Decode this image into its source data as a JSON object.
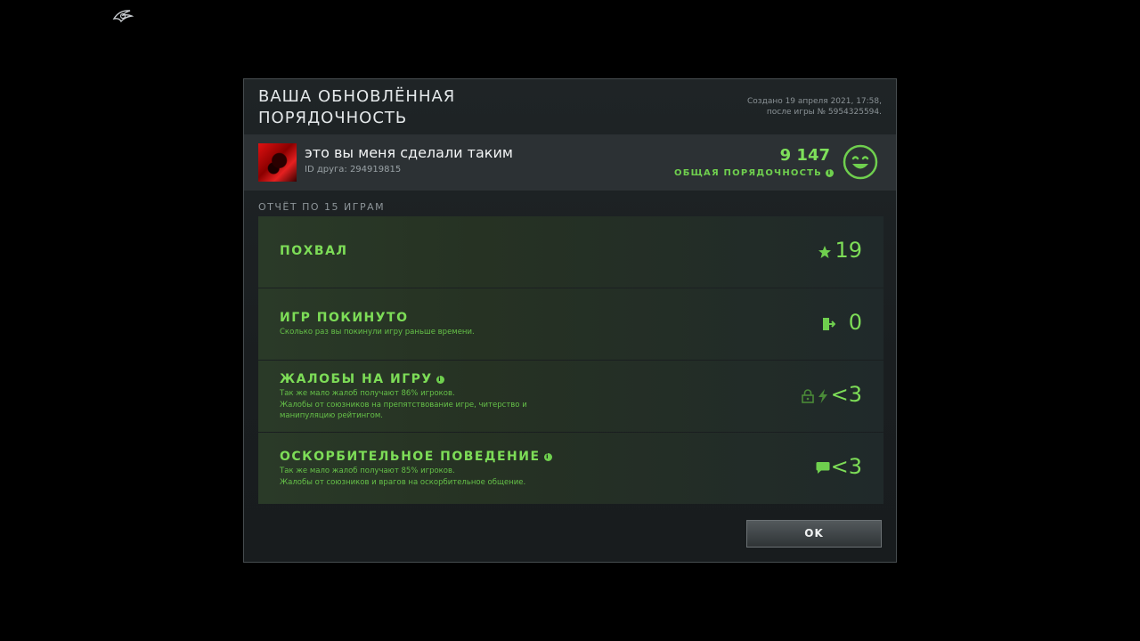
{
  "header": {
    "title": "ВАША ОБНОВЛЁННАЯ\nПОРЯДОЧНОСТЬ",
    "created": "Создано 19 апреля 2021, 17:58,\nпосле игры № 5954325594."
  },
  "profile": {
    "nickname": "это вы меня сделали таким",
    "friend_id": "ID друга: 294919815",
    "behavior_score": "9 147",
    "behavior_label": "ОБЩАЯ ПОРЯДОЧНОСТЬ"
  },
  "report": {
    "title": "ОТЧЁТ ПО 15 ИГРАМ",
    "rows": [
      {
        "label": "ПОХВАЛ",
        "desc": "",
        "value": "19",
        "icons": [
          "commend-star-icon"
        ]
      },
      {
        "label": "ИГР ПОКИНУТО",
        "desc": "Сколько раз вы покинули игру раньше времени.",
        "value": "0",
        "icons": [
          "abandon-door-icon"
        ]
      },
      {
        "label": "ЖАЛОБЫ НА ИГРУ",
        "desc": "Так же мало жалоб получают 86% игроков.\nЖалобы от союзников на препятствование игре, читерство и\nманипуляцию рейтингом.",
        "value": "<3",
        "icons": [
          "lock-icon",
          "lightning-icon"
        ]
      },
      {
        "label": "ОСКОРБИТЕЛЬНОЕ ПОВЕДЕНИЕ",
        "desc": "Так же мало жалоб получают 85% игроков.\nЖалобы от союзников и врагов на оскорбительное общение.",
        "value": "<3",
        "icons": [
          "chat-bubble-icon"
        ]
      }
    ]
  },
  "buttons": {
    "ok_label": "OK"
  },
  "colors": {
    "accent_green": "#7ddd57",
    "panel_bg": "#1f2426"
  }
}
